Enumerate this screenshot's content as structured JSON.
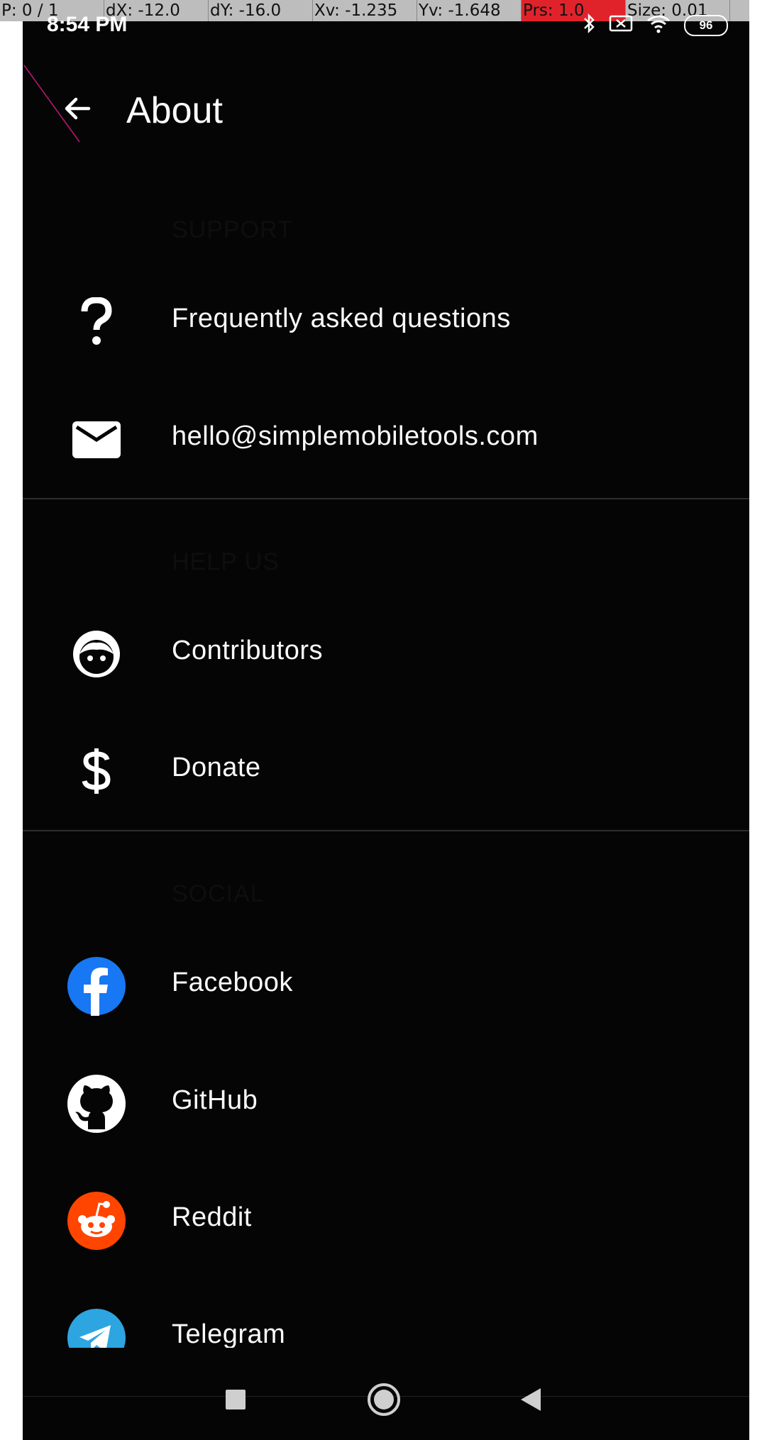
{
  "debug": {
    "p": "P: 0 / 1",
    "dx": "dX: -12.0",
    "dy": "dY: -16.0",
    "xv": "Xv: -1.235",
    "yv": "Yv: -1.648",
    "prs": "Prs: 1.0",
    "size": "Size: 0.01"
  },
  "status_bar": {
    "time": "8:54 PM",
    "battery": "96",
    "icons": [
      "bluetooth-icon",
      "screen-cast-icon",
      "wifi-icon",
      "battery-icon"
    ]
  },
  "toolbar": {
    "title": "About",
    "back_icon": "arrow-left-icon"
  },
  "sections": {
    "support": {
      "header": "SUPPORT",
      "items": [
        {
          "label": "Frequently asked questions",
          "icon": "question-mark-icon"
        },
        {
          "label": "hello@simplemobiletools.com",
          "icon": "email-icon"
        }
      ]
    },
    "help_us": {
      "header": "HELP US",
      "items": [
        {
          "label": "Contributors",
          "icon": "face-icon"
        },
        {
          "label": "Donate",
          "icon": "dollar-icon"
        }
      ]
    },
    "social": {
      "header": "SOCIAL",
      "items": [
        {
          "label": "Facebook",
          "icon": "facebook-icon"
        },
        {
          "label": "GitHub",
          "icon": "github-icon"
        },
        {
          "label": "Reddit",
          "icon": "reddit-icon"
        },
        {
          "label": "Telegram",
          "icon": "telegram-icon"
        }
      ]
    }
  },
  "nav_bar": {
    "buttons": [
      "recents-icon",
      "home-icon",
      "back-triangle-icon"
    ]
  },
  "colors": {
    "background": "#050505",
    "text": "#fafafa",
    "facebook": "#1877f2",
    "reddit": "#ff4500",
    "telegram": "#2ca5e0",
    "debug_red": "#e0232b"
  }
}
